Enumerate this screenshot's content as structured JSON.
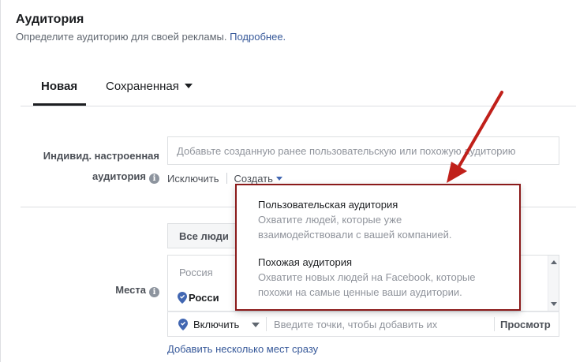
{
  "header": {
    "title": "Аудитория",
    "subtitle": "Определите аудиторию для своей рекламы.",
    "more_link": "Подробнее."
  },
  "tabs": [
    {
      "label": "Новая",
      "active": true
    },
    {
      "label": "Сохраненная",
      "active": false
    }
  ],
  "custom_audience": {
    "label_line1": "Индивид. настроенная",
    "label_line2": "аудитория",
    "placeholder": "Добавьте созданную ранее пользовательскую или похожую аудиторию",
    "exclude_link": "Исключить",
    "create_link": "Создать"
  },
  "create_menu": {
    "items": [
      {
        "title": "Пользовательская аудитория",
        "desc_line1": "Охватите людей, которые уже",
        "desc_line2": "взаимодействовали с вашей компанией."
      },
      {
        "title": "Похожая аудитория",
        "desc_line1": "Охватите новых людей на Facebook, которые",
        "desc_line2": "похожи на самые ценные ваши аудитории."
      }
    ]
  },
  "locations": {
    "label": "Места",
    "all_people": "Все люди",
    "country_header": "Россия",
    "selected_location": "Росси",
    "include_label": "Включить",
    "input_placeholder": "Введите точки, чтобы добавить их",
    "preview_button": "Просмотр",
    "bulk_link": "Добавить несколько мест сразу"
  },
  "colors": {
    "link": "#365899",
    "annotation": "#c0201a",
    "dropdown_border": "#8b1a1a"
  }
}
